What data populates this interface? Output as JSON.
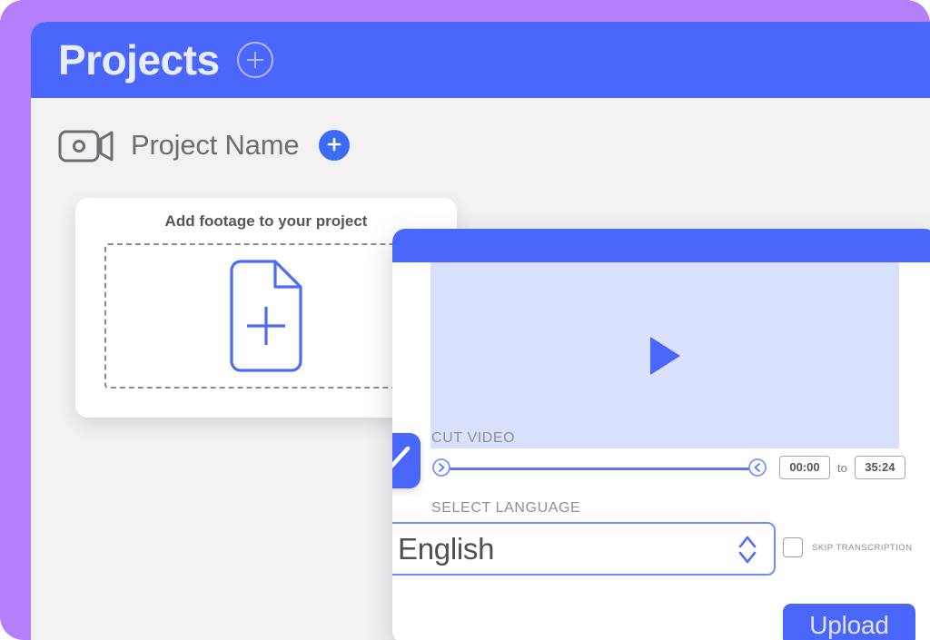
{
  "colors": {
    "brand_blue": "#4a66fb",
    "accent_purple": "#b47ffb",
    "preview_fill": "#d9e0fb",
    "app_background": "#f2f2f3",
    "muted_text": "#8f8f99"
  },
  "header": {
    "title": "Projects",
    "add_icon": "plus-circle-outline-icon"
  },
  "project_row": {
    "camera_icon": "video-camera-icon",
    "name": "Project Name",
    "add_icon": "plus-icon"
  },
  "footage_card": {
    "title": "Add footage to your project",
    "dropzone_icon": "document-add-icon"
  },
  "modal": {
    "preview": {
      "play_icon": "play-icon"
    },
    "enabled_badge": {
      "icon": "checkmark-icon",
      "checked": true
    },
    "cut_video": {
      "label": "CUT VIDEO",
      "handle_left_icon": "chevron-right-circle-icon",
      "handle_right_icon": "chevron-left-circle-icon",
      "start_time": "00:00",
      "separator": "to",
      "end_time": "35:24"
    },
    "select_language": {
      "label": "SELECT LANGUAGE",
      "value": "English",
      "stepper_icon": "chevron-up-down-icon"
    },
    "skip_transcription": {
      "label": "SKIP TRANSCRIPTION",
      "checked": false,
      "checkbox_icon": "checkbox-empty-icon"
    },
    "upload_button": {
      "label": "Upload"
    }
  }
}
